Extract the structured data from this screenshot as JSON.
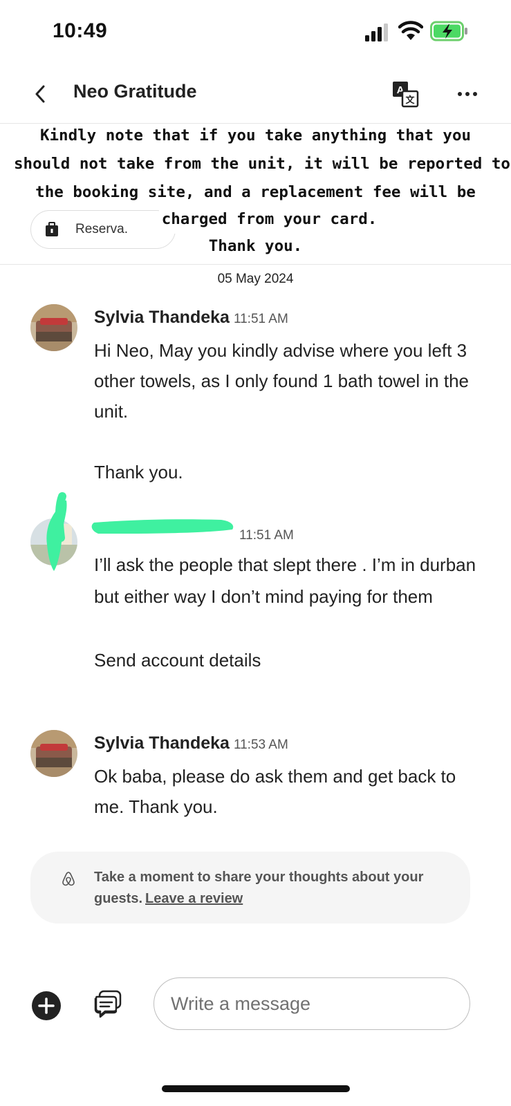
{
  "status_bar": {
    "time": "10:49"
  },
  "header": {
    "title": "Neo Gratitude"
  },
  "reservation_chip": {
    "label": "Reserva."
  },
  "overlay_note": {
    "lines": [
      "Kindly note that if you take anything that you",
      "should not take from the unit, it will be reported to",
      "the booking site, and a replacement fee will be",
      "charged from your card.",
      "Thank you."
    ]
  },
  "date_label": "05 May 2024",
  "messages": [
    {
      "sender": "Sylvia Thandeka",
      "time": "11:51 AM",
      "text": "Hi Neo, May you kindly advise where you left 3 other towels, as I only found 1 bath towel in the unit.\n\nThank you."
    },
    {
      "sender": "",
      "time": "11:51 AM",
      "text": "I’ll ask the people that slept there . I’m in durban but either way I don’t mind paying for them\n\nSend account details"
    },
    {
      "sender": "Sylvia Thandeka",
      "time": "11:53 AM",
      "text": "Ok baba, please do ask them and get back to me. Thank you."
    }
  ],
  "review_prompt": {
    "text": "Take a moment to share your thoughts about your guests.",
    "link": "Leave a review"
  },
  "composer": {
    "placeholder": "Write a message"
  },
  "colors": {
    "redaction": "#3ff0a0",
    "text": "#222222",
    "muted": "#717171"
  },
  "icons": [
    "signal-icon",
    "wifi-icon",
    "battery-charging-icon",
    "chevron-left-icon",
    "translate-icon",
    "more-icon",
    "briefcase-icon",
    "airbnb-logo-icon",
    "plus-icon",
    "quick-reply-icon"
  ]
}
